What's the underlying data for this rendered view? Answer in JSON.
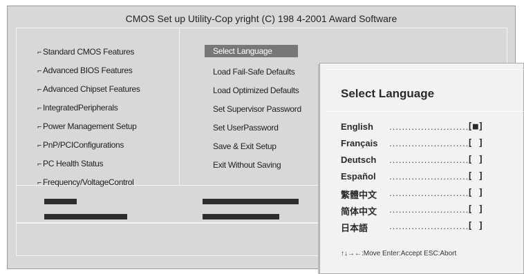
{
  "bios": {
    "title": "CMOS Set up Utility-Cop yright (C) 198 4-2001 Award Software",
    "left_menu": [
      {
        "label": "Standard CMOS Features"
      },
      {
        "label": "Advanced BIOS Features"
      },
      {
        "label": "Advanced Chipset Features"
      },
      {
        "label": "IntegratedPeripherals"
      },
      {
        "label": "Power Management Setup"
      },
      {
        "label": "PnP/PCIConfigurations"
      },
      {
        "label": "PC Health Status"
      },
      {
        "label": "Frequency/VoltageControl"
      }
    ],
    "arrow_glyph": "⌐",
    "right_menu": [
      {
        "label": "Select Language",
        "selected": true
      },
      {
        "label": "Load Fail-Safe Defaults"
      },
      {
        "label": "Load Optimized Defaults"
      },
      {
        "label": "Set Supervisor Password"
      },
      {
        "label": "Set UserPassword"
      },
      {
        "label": "Save & Exit Setup"
      },
      {
        "label": "Exit Without Saving"
      }
    ]
  },
  "popup": {
    "title": "Select Language",
    "languages": [
      {
        "name": "English",
        "mark": "[■]"
      },
      {
        "name": "Français",
        "mark": "[ ]"
      },
      {
        "name": "Deutsch",
        "mark": "[ ]"
      },
      {
        "name": "Español",
        "mark": "[ ]"
      },
      {
        "name": "繁體中文",
        "mark": "[ ]"
      },
      {
        "name": "简体中文",
        "mark": "[ ]"
      },
      {
        "name": "日本語",
        "mark": "[ ]"
      }
    ],
    "dots": "......................................",
    "nav_hint": "↑↓→←:Move  Enter:Accept  ESC:Abort"
  },
  "colors": {
    "bios_bg": "#d8d8d8",
    "selected_bg": "#777777",
    "popup_bg": "#f2f2f2",
    "help_bar": "#2e2e2e"
  }
}
